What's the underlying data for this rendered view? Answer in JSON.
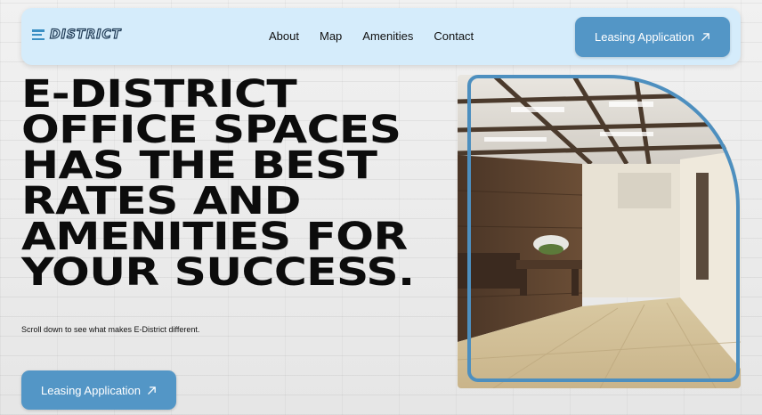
{
  "brand": {
    "logo_text": "DISTRICT",
    "logo_icon": "equals-bars-icon"
  },
  "nav": {
    "links": [
      {
        "label": "About"
      },
      {
        "label": "Map"
      },
      {
        "label": "Amenities"
      },
      {
        "label": "Contact"
      }
    ],
    "cta_label": "Leasing Application",
    "cta_icon": "arrow-up-right-icon"
  },
  "hero": {
    "title_lines": [
      "E-DISTRICT",
      "OFFICE SPACES",
      "HAS THE BEST",
      "RATES AND",
      "AMENITIES FOR",
      "YOUR SUCCESS."
    ],
    "subtext": "Scroll down to see what makes E-District different.",
    "cta_label": "Leasing Application",
    "cta_icon": "arrow-up-right-icon"
  },
  "colors": {
    "accent": "#5396c6",
    "nav_bg": "#d5ecfb",
    "frame": "#4d8fbf",
    "text": "#0c0c0c"
  }
}
